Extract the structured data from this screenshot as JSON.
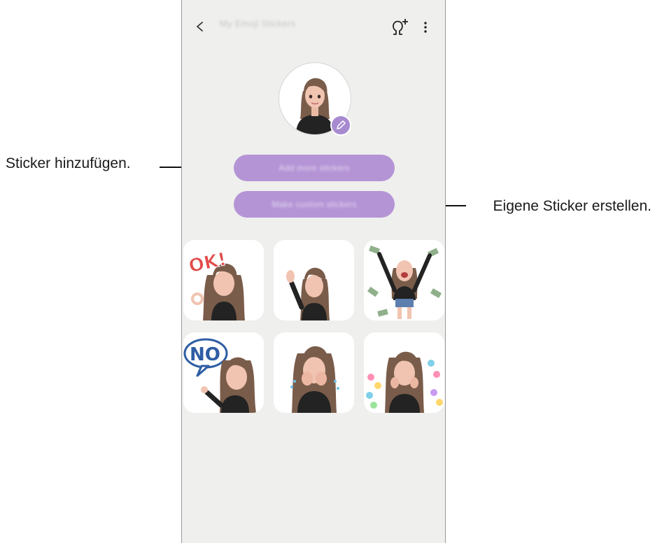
{
  "header": {
    "title": "My Emoji Stickers",
    "back_icon": "chevron-left-icon",
    "add_avatar_icon": "avatar-add-icon",
    "more_icon": "more-vertical-icon"
  },
  "profile": {
    "edit_icon": "pencil-icon"
  },
  "buttons": {
    "add_label": "Add more stickers",
    "make_label": "Make custom stickers"
  },
  "stickers": [
    {
      "name": "ok-sticker",
      "text": "OK!"
    },
    {
      "name": "wave-sticker",
      "text": ""
    },
    {
      "name": "money-sticker",
      "text": ""
    },
    {
      "name": "no-sticker",
      "text": "NO"
    },
    {
      "name": "crying-sticker",
      "text": ""
    },
    {
      "name": "hearts-sticker",
      "text": ""
    }
  ],
  "callouts": {
    "left": "Sticker hinzufügen.",
    "right": "Eigene Sticker erstellen."
  },
  "colors": {
    "accent": "#b594d6",
    "background": "#efefed",
    "tile": "#ffffff"
  }
}
